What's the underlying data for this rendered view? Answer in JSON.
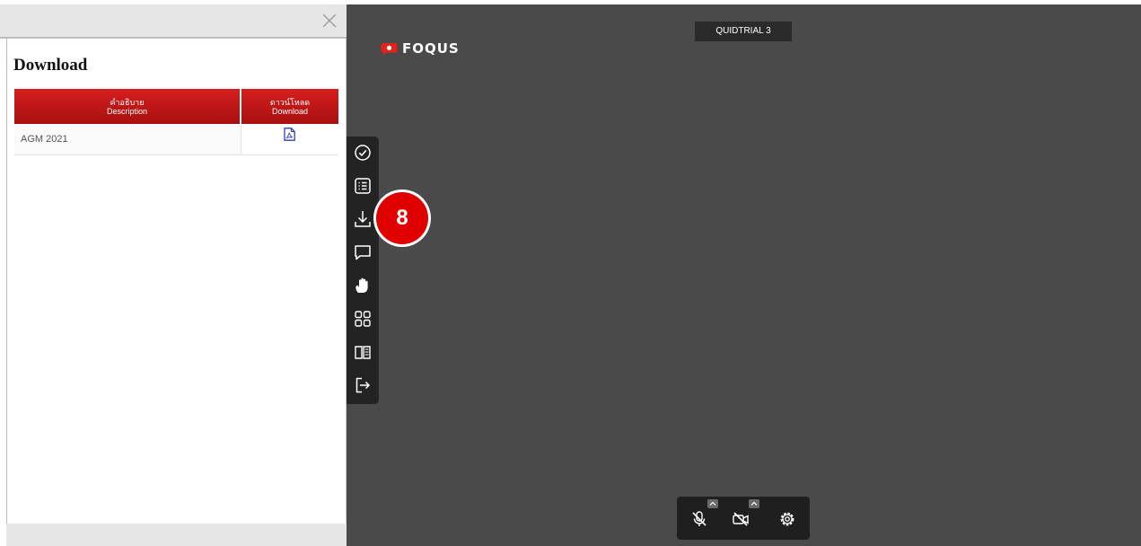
{
  "download_panel": {
    "title": "Download",
    "close_icon": "close-icon",
    "table": {
      "headers": [
        {
          "thai": "คำอธิบาย",
          "en": "Description"
        },
        {
          "thai": "ดาวน์โหลด",
          "en": "Download"
        }
      ],
      "rows": [
        {
          "description": "AGM 2021",
          "file_icon": "pdf-file-icon"
        }
      ]
    }
  },
  "meeting": {
    "room_name": "QUIDTRIAL 3",
    "logo_text": "FOQUS",
    "brand_color": "#e00000",
    "background_color": "#4a4a4a"
  },
  "side_toolbar": {
    "items": [
      {
        "name": "vote",
        "icon": "check-circle-icon"
      },
      {
        "name": "agenda",
        "icon": "list-icon"
      },
      {
        "name": "download",
        "icon": "download-icon"
      },
      {
        "name": "chat",
        "icon": "chat-icon"
      },
      {
        "name": "raise-hand",
        "icon": "hand-icon"
      },
      {
        "name": "layout",
        "icon": "grid-icon"
      },
      {
        "name": "document",
        "icon": "book-icon"
      },
      {
        "name": "exit",
        "icon": "exit-icon"
      }
    ]
  },
  "annotation": {
    "step_number": "8"
  },
  "bottom_controls": {
    "items": [
      {
        "name": "microphone",
        "icon": "mic-muted-icon",
        "state": "muted"
      },
      {
        "name": "camera",
        "icon": "camera-off-icon",
        "state": "off"
      },
      {
        "name": "settings",
        "icon": "gear-icon"
      }
    ]
  }
}
